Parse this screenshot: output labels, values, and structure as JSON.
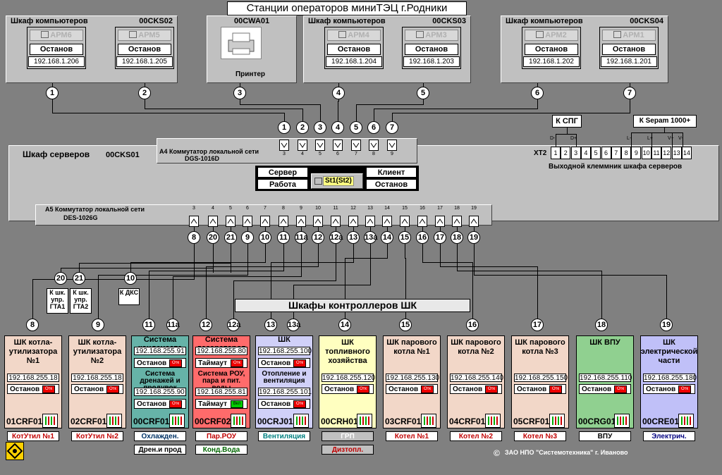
{
  "title": "Станции операторов миниТЭЦ г.Родники",
  "top_cabinets": [
    {
      "name": "Шкаф компьютеров",
      "code": "00CKS02",
      "stations": [
        {
          "arm": "АРМ6",
          "state": "Останов",
          "ip": "192.168.1.206"
        },
        {
          "arm": "АРМ5",
          "state": "Останов",
          "ip": "192.168.1.205"
        }
      ]
    },
    {
      "name": "Шкаф компьютеров",
      "code": "00CKS03",
      "stations": [
        {
          "arm": "АРМ4",
          "state": "Останов",
          "ip": "192.168.1.204"
        },
        {
          "arm": "АРМ3",
          "state": "Останов",
          "ip": "192.168.1.203"
        }
      ]
    },
    {
      "name": "Шкаф компьютеров",
      "code": "00CKS04",
      "stations": [
        {
          "arm": "АРМ2",
          "state": "Останов",
          "ip": "192.168.1.202"
        },
        {
          "arm": "АРМ1",
          "state": "Останов",
          "ip": "192.168.1.201"
        }
      ]
    }
  ],
  "printer": {
    "code": "00CWA01",
    "label": "Принтер"
  },
  "top_numbers": [
    "1",
    "2",
    "3",
    "4",
    "5",
    "6",
    "7"
  ],
  "switch_numbers": [
    "1",
    "2",
    "3",
    "4",
    "5",
    "6",
    "7"
  ],
  "server": {
    "name": "Шкаф серверов",
    "code": "00CKS01",
    "a4_label": "А4  Коммутатор локальной сети",
    "a4_model": "DGS-1016D",
    "a4_ports": [
      "3",
      "4",
      "5",
      "6",
      "7",
      "8",
      "9"
    ],
    "a5_label": "А5  Коммутатор локальной сети",
    "a5_model": "DES-1026G",
    "a5_ports": [
      "3",
      "4",
      "5",
      "6",
      "7",
      "8",
      "9",
      "10",
      "11",
      "12",
      "13",
      "14",
      "15",
      "16",
      "17",
      "18",
      "19"
    ],
    "row1_left": "Сервер",
    "row1_right": "Клиент",
    "row2_left": "Работа",
    "row2_right": "Останов",
    "st_label": "St1(St2)",
    "xt2": "ХТ2",
    "terminal_label": "Выходной клеммник шкафа серверов",
    "terminals": [
      "1",
      "2",
      "3",
      "4",
      "5",
      "6",
      "7",
      "8",
      "9",
      "10",
      "11",
      "12",
      "13",
      "14"
    ],
    "spg": "К СПГ",
    "sepam": "К Sepam 1000+",
    "spg_pins": [
      "D-",
      "D+"
    ],
    "sepam_pins": [
      "L-",
      "L+",
      "V+",
      "V-"
    ]
  },
  "a5_numbers": [
    "8",
    "20",
    "21",
    "9",
    "10",
    "11",
    "11а",
    "12",
    "12а",
    "13",
    "13а",
    "14",
    "15",
    "16",
    "17",
    "18",
    "19"
  ],
  "gta": [
    {
      "num": "20",
      "label": "К шк. упр. ГТА1"
    },
    {
      "num": "21",
      "label": "К шк. упр. ГТА2"
    }
  ],
  "dks": {
    "num": "10",
    "label": "К ДКС"
  },
  "controllers_header": "Шкафы контроллеров ШК",
  "cards": [
    {
      "num": "8",
      "title": "ШК котла-утилизатора №1",
      "ip": "192.168.255.18",
      "state": "Останов",
      "code": "01CRF01",
      "btn": "КотУтил №1",
      "bg": "#f2d7c8",
      "btncolor": "#c00000"
    },
    {
      "num": "9",
      "title": "ШК котла-утилизатора №2",
      "ip": "192.168.255.18",
      "state": "Останов",
      "code": "02CRF01",
      "btn": "КотУтил №2",
      "bg": "#f2d7c8",
      "btncolor": "#c00000"
    },
    {
      "num": "11",
      "num2": "11а",
      "title": "Система конденсата",
      "ip": "192.168.255.91",
      "title2": "Система дренажей и продувок",
      "ip2": "192.168.255.90",
      "state": "Останов",
      "code": "00CRF01",
      "btn": "Охлажден.",
      "btn2": "Дрен.и прод",
      "bg": "#66b3a8",
      "btncolor": "#003366"
    },
    {
      "num": "12",
      "num2": "12а",
      "title": "Система деаэраторов",
      "ip": "192.168.255.80",
      "title2": "Система РОУ, пара и пит. воды",
      "ip2": "192.168.255.81",
      "state": "Таймаут",
      "code": "00CRF02",
      "btn": "Пар.РОУ",
      "btn2": "Конд.Вода",
      "bg": "#ff6b6b",
      "btncolor": "#c00000"
    },
    {
      "num": "13",
      "num2": "13а",
      "title": "ШК",
      "ip": "192.168.255.100",
      "title2": "Отопление и вентиляция",
      "ip2": "192.168.255.101",
      "state": "Останов",
      "code": "00CRJ01",
      "btn": "Вентиляция",
      "bg": "#d0d0f8",
      "btncolor": "#008080"
    },
    {
      "num": "14",
      "title": "ШК топливного хозяйства",
      "ip": "192.168.255.120",
      "state": "Останов",
      "code": "00CRH01",
      "btn": "ГРП",
      "btn2": "Дизтопл.",
      "bg": "#ffffc0",
      "btncolor": "#c00000"
    },
    {
      "num": "15",
      "title": "ШК парового котла №1",
      "ip": "192.168.255.130",
      "state": "Останов",
      "code": "03CRF01",
      "btn": "Котел №1",
      "bg": "#f2d7c8",
      "btncolor": "#c00000"
    },
    {
      "num": "16",
      "title": "ШК парового котла №2",
      "ip": "192.168.255.140",
      "state": "Останов",
      "code": "04CRF01",
      "btn": "Котел №2",
      "bg": "#f2d7c8",
      "btncolor": "#c00000"
    },
    {
      "num": "17",
      "title": "ШК парового котла №3",
      "ip": "192.168.255.150",
      "state": "Останов",
      "code": "05CRF01",
      "btn": "Котел №3",
      "bg": "#f2d7c8",
      "btncolor": "#c00000"
    },
    {
      "num": "18",
      "title": "ШК ВПУ",
      "ip": "192.168.255.110",
      "state": "Останов",
      "code": "00CRG01",
      "btn": "ВПУ",
      "bg": "#90d090",
      "btncolor": "#000000"
    },
    {
      "num": "19",
      "title": "ШК электрической части",
      "ip": "192.168.255.180",
      "state": "Останов",
      "code": "00CRE01",
      "btn": "Электрич.",
      "bg": "#c0c0f8",
      "btncolor": "#000080"
    }
  ],
  "otk": "Отк",
  "vkl": "Вкл",
  "copyright": "ЗАО НПО \"Системотехника\" г. Иваново",
  "copyright_symbol": "©",
  "colors": {
    "bg": "#808080",
    "panel": "#c0c0c0"
  }
}
